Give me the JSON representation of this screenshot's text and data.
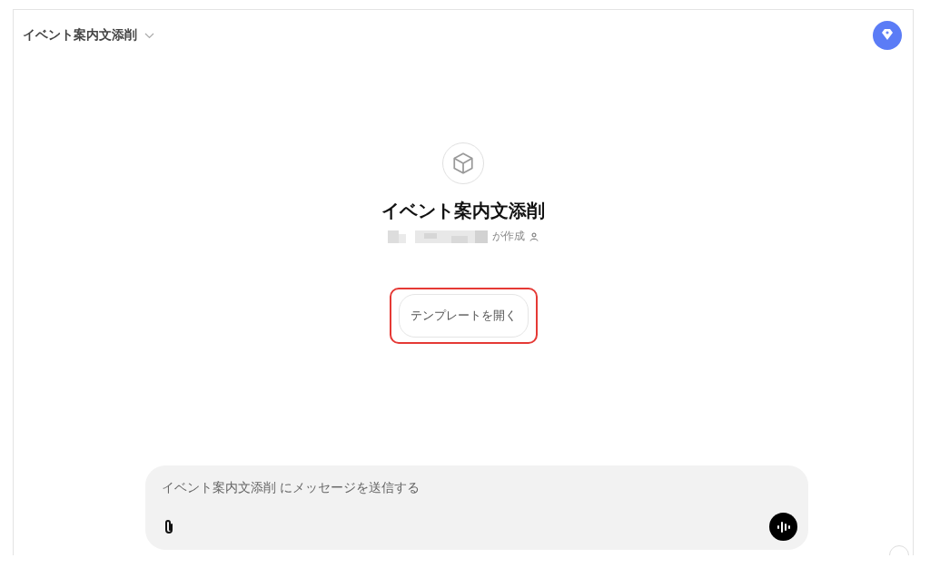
{
  "header": {
    "title": "イベント案内文添削"
  },
  "gpt": {
    "title": "イベント案内文添削",
    "creator_suffix": "が作成"
  },
  "template_button": {
    "label": "テンプレートを開く",
    "highlighted": true
  },
  "composer": {
    "placeholder": "イベント案内文添削 にメッセージを送信する"
  }
}
